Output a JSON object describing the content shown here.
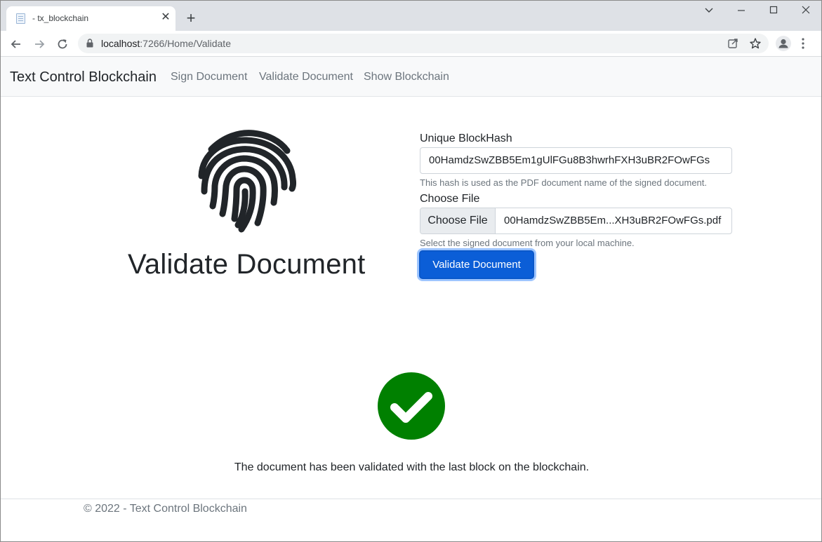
{
  "browser": {
    "tab_title": "- tx_blockchain",
    "tab_close": "✕",
    "new_tab": "+",
    "url_host": "localhost",
    "url_path": ":7266/Home/Validate"
  },
  "navbar": {
    "brand": "Text Control Blockchain",
    "links": [
      "Sign Document",
      "Validate Document",
      "Show Blockchain"
    ]
  },
  "main": {
    "heading": "Validate Document",
    "hash_label": "Unique BlockHash",
    "hash_value": "00HamdzSwZBB5Em1gUlFGu8B3hwrhFXH3uBR2FOwFGs",
    "hash_help": "This hash is used as the PDF document name of the signed document.",
    "file_label": "Choose File",
    "file_button": "Choose File",
    "file_name": "00HamdzSwZBB5Em...XH3uBR2FOwFGs.pdf",
    "file_help": "Select the signed document from your local machine.",
    "submit": "Validate Document",
    "result_message": "The document has been validated with the last block on the blockchain."
  },
  "footer": {
    "copyright": "© 2022 - Text Control Blockchain"
  },
  "colors": {
    "success": "#008000",
    "primary": "#0b5ed7"
  }
}
